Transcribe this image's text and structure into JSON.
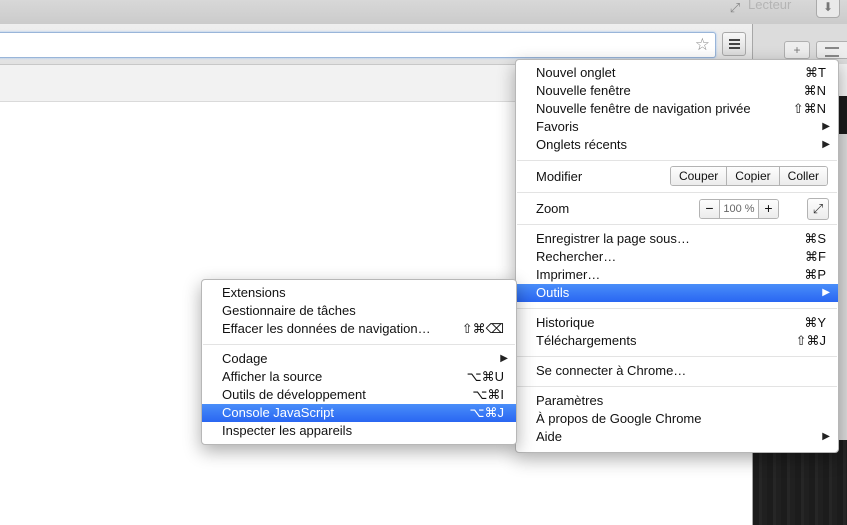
{
  "top_bar": {
    "fullscreen_icon": "fullscreen-icon",
    "profile_label": "Lecteur",
    "download_icon": "download-icon"
  },
  "browser": {
    "star_icon": "star-icon",
    "menu_icon": "hamburger-menu-icon"
  },
  "background_window": {
    "tab_icons": [
      "plus-icon",
      "list-icon"
    ]
  },
  "colors": {
    "highlight_top": "#4a8ef9",
    "highlight_bottom": "#2966f2",
    "menu_border": "#b7b7b7"
  },
  "chrome_menu": {
    "new_tab": {
      "label": "Nouvel onglet",
      "shortcut": "⌘T"
    },
    "new_window": {
      "label": "Nouvelle fenêtre",
      "shortcut": "⌘N"
    },
    "new_private_window": {
      "label": "Nouvelle fenêtre de navigation privée",
      "shortcut": "⇧⌘N"
    },
    "bookmarks": {
      "label": "Favoris"
    },
    "recent_tabs": {
      "label": "Onglets récents"
    },
    "edit": {
      "label": "Modifier",
      "cut": "Couper",
      "copy": "Copier",
      "paste": "Coller"
    },
    "zoom": {
      "label": "Zoom",
      "minus": "−",
      "level": "100 %",
      "plus": "+"
    },
    "save_page": {
      "label": "Enregistrer la page sous…",
      "shortcut": "⌘S"
    },
    "find": {
      "label": "Rechercher…",
      "shortcut": "⌘F"
    },
    "print": {
      "label": "Imprimer…",
      "shortcut": "⌘P"
    },
    "tools": {
      "label": "Outils"
    },
    "history": {
      "label": "Historique",
      "shortcut": "⌘Y"
    },
    "downloads": {
      "label": "Téléchargements",
      "shortcut": "⇧⌘J"
    },
    "sign_in": {
      "label": "Se connecter à Chrome…"
    },
    "settings": {
      "label": "Paramètres"
    },
    "about": {
      "label": "À propos de Google Chrome"
    },
    "help": {
      "label": "Aide"
    },
    "arrow": "▶"
  },
  "tools_submenu": {
    "extensions": {
      "label": "Extensions"
    },
    "task_manager": {
      "label": "Gestionnaire de tâches"
    },
    "clear_data": {
      "label": "Effacer les données de navigation…",
      "shortcut": "⇧⌘⌫"
    },
    "encoding": {
      "label": "Codage"
    },
    "view_source": {
      "label": "Afficher la source",
      "shortcut": "⌥⌘U"
    },
    "dev_tools": {
      "label": "Outils de développement",
      "shortcut": "⌥⌘I"
    },
    "js_console": {
      "label": "Console JavaScript",
      "shortcut": "⌥⌘J"
    },
    "inspect_devices": {
      "label": "Inspecter les appareils"
    }
  }
}
